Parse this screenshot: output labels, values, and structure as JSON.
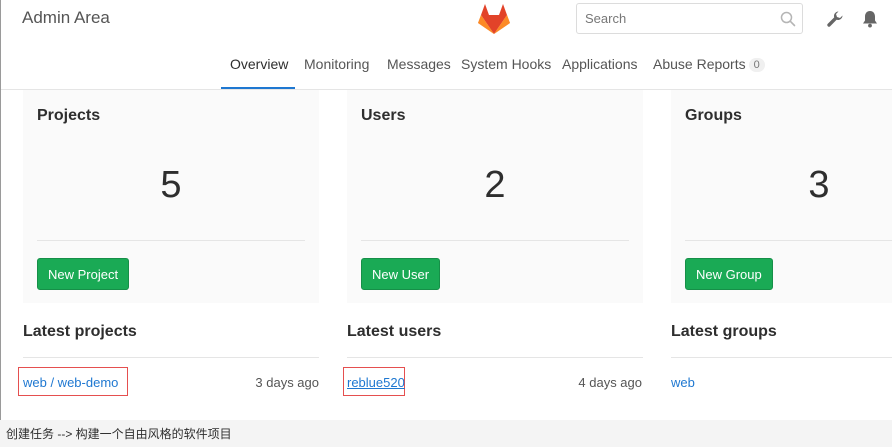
{
  "header": {
    "title": "Admin Area",
    "logo": "gitlab-tanuki-logo",
    "search_placeholder": "Search",
    "icons": [
      "search-icon",
      "wrench-icon",
      "bell-icon"
    ]
  },
  "nav": {
    "tabs": [
      {
        "label": "Overview",
        "active": true
      },
      {
        "label": "Monitoring"
      },
      {
        "label": "Messages"
      },
      {
        "label": "System Hooks"
      },
      {
        "label": "Applications"
      },
      {
        "label": "Abuse Reports",
        "badge": "0"
      }
    ]
  },
  "cards": [
    {
      "title": "Projects",
      "count": "5",
      "button": "New Project"
    },
    {
      "title": "Users",
      "count": "2",
      "button": "New User"
    },
    {
      "title": "Groups",
      "count": "3",
      "button": "New Group"
    }
  ],
  "latest": {
    "projects": {
      "title": "Latest projects",
      "item": "web / web-demo",
      "time": "3 days ago"
    },
    "users": {
      "title": "Latest users",
      "item": "reblue520",
      "time": "4 days ago"
    },
    "groups": {
      "title": "Latest groups",
      "item": "web"
    }
  },
  "caption": "创建任务 --> 构建一个自由风格的软件项目",
  "colors": {
    "accent": "#1f78d1",
    "button": "#1aaa55",
    "highlight": "#e54f4f"
  }
}
